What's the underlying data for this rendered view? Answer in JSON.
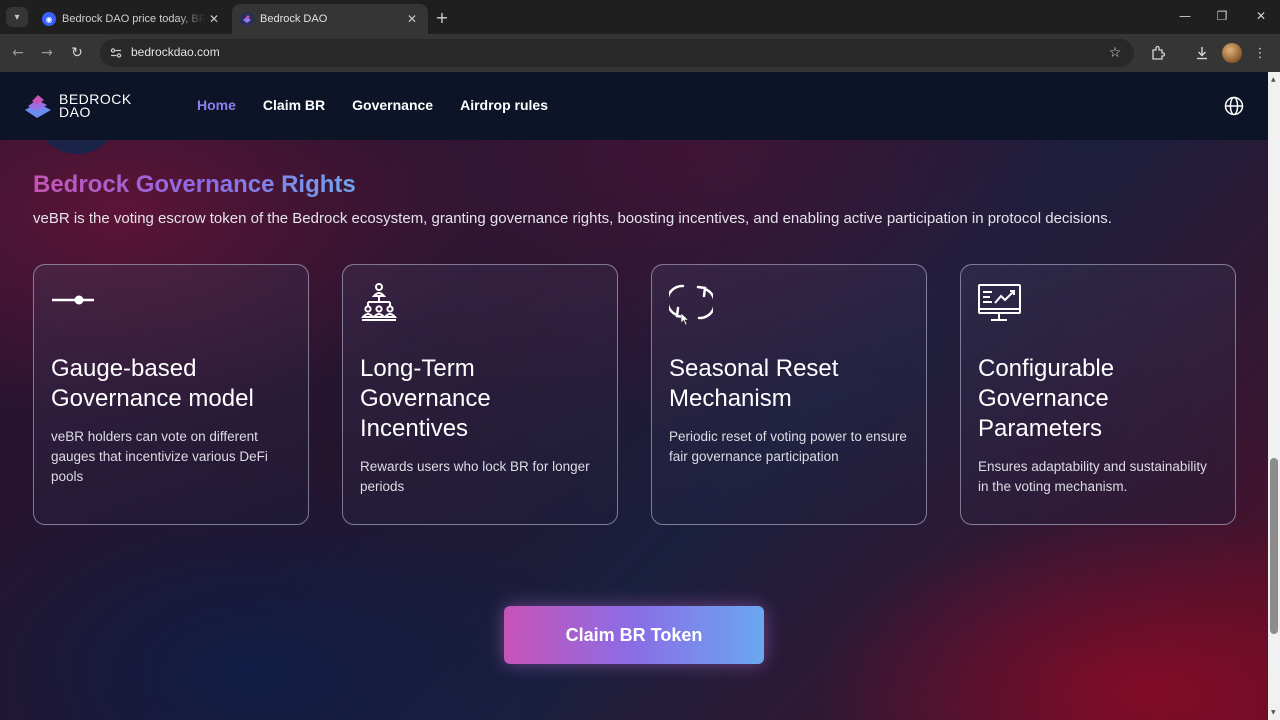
{
  "browser": {
    "tabs": [
      {
        "title": "Bedrock DAO price today, BR to USD live price, marketcap and chart | CoinMarketCap",
        "active": false
      },
      {
        "title": "Bedrock DAO",
        "active": true
      }
    ],
    "url": "bedrockdao.com"
  },
  "header": {
    "logo_line1": "BEDROCK",
    "logo_line2": "DAO",
    "nav": [
      {
        "label": "Home",
        "active": true
      },
      {
        "label": "Claim BR",
        "active": false
      },
      {
        "label": "Governance",
        "active": false
      },
      {
        "label": "Airdrop rules",
        "active": false
      }
    ]
  },
  "section": {
    "title": "Bedrock Governance Rights",
    "description": "veBR is the voting escrow token of the Bedrock ecosystem, granting governance rights, boosting incentives, and enabling active participation in protocol decisions."
  },
  "cards": [
    {
      "icon": "slider-icon",
      "title": "Gauge-based Governance model",
      "text": "veBR holders can vote on different gauges that incentivize various DeFi pools"
    },
    {
      "icon": "hierarchy-icon",
      "title": "Long-Term Governance Incentives",
      "text": "Rewards users who lock BR for longer periods"
    },
    {
      "icon": "refresh-icon",
      "title": "Seasonal Reset Mechanism",
      "text": "Periodic reset of voting power to ensure fair governance participation"
    },
    {
      "icon": "chart-monitor-icon",
      "title": "Configurable Governance Parameters",
      "text": "Ensures adaptability and sustainability in the voting mechanism."
    }
  ],
  "cta_label": "Claim BR Token",
  "colors": {
    "nav_active": "#8f7ef0",
    "gradient_start": "#c653b6",
    "gradient_mid": "#8a6de6",
    "gradient_end": "#6aa8f0",
    "header_bg": "#0e1427"
  }
}
